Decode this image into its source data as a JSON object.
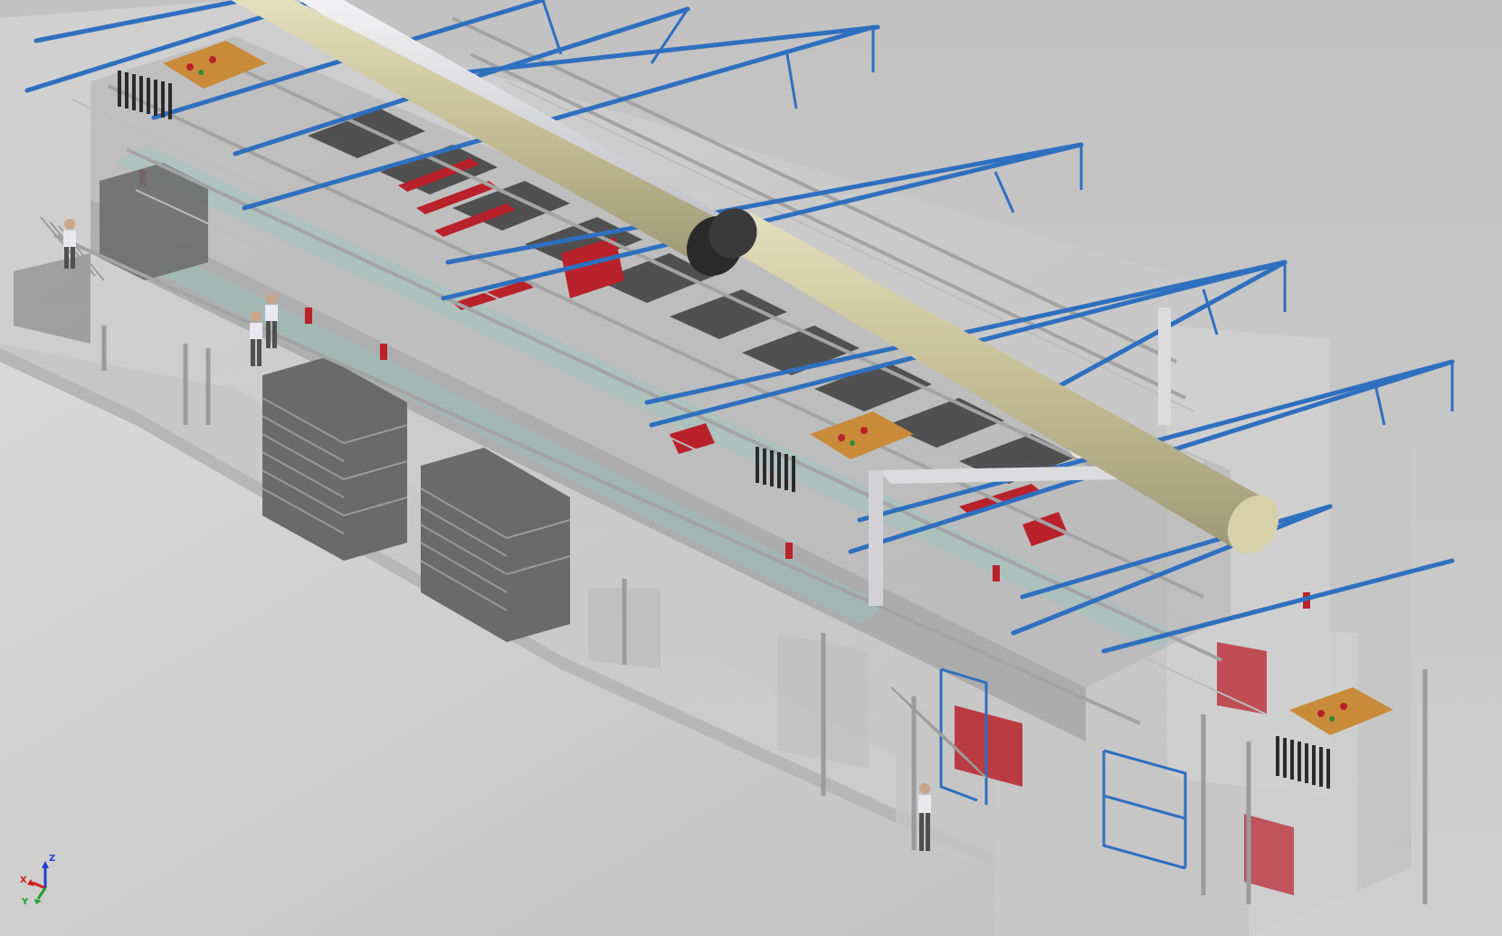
{
  "viewport": {
    "background": "#c6c6c6"
  },
  "model": {
    "colors": {
      "truss": "#2f6fbf",
      "main_pipe": "#c8c29c",
      "secondary_pipe": "#d7d8dc",
      "steel": "#a7a7a7",
      "tanks": "#5c5c5c",
      "red_parts": "#b9222a",
      "control_panels": "#c98b3a",
      "walls": "#d7d7d7",
      "glass": "#9cc9c0"
    }
  },
  "triad": {
    "x_label": "X",
    "y_label": "Y",
    "z_label": "Z",
    "x_color": "#cc2020",
    "y_color": "#1f9e2e",
    "z_color": "#2040cc"
  }
}
